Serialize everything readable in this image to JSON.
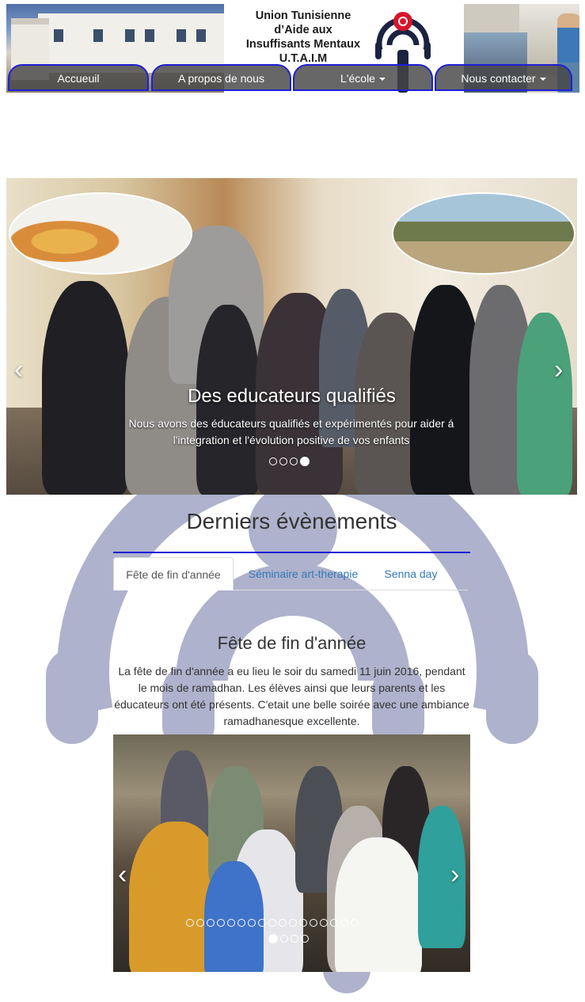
{
  "header": {
    "title_lines": [
      "Union Tunisienne",
      "d’Aide aux",
      "Insuffisants Mentaux",
      "U.T.A.I.M"
    ]
  },
  "nav": {
    "items": [
      {
        "label": "Accueuil",
        "dropdown": false
      },
      {
        "label": "A propos de nous",
        "dropdown": false
      },
      {
        "label": "L'école",
        "dropdown": true
      },
      {
        "label": "Nous contacter",
        "dropdown": true
      }
    ]
  },
  "hero": {
    "caption_title": "Des educateurs qualifiés",
    "caption_text": "Nous avons des éducateurs qualifiés et expérimentés pour aider á l'integration et l'évolution positive de vos enfants",
    "slide_count": 4,
    "active_slide": 4
  },
  "events": {
    "heading": "Derniers évènements",
    "tabs": [
      "Fête de fin d'année",
      "Séminaire art-therapie",
      "Senna day"
    ],
    "active_tab": 0,
    "active": {
      "title": "Fête de fin d'année",
      "text": "La fête de fin d'année a eu lieu le soir du samedi 11 juin 2016, pendant le mois de ramadhan. Les élèves ainsi que leurs parents et les éducateurs ont été présents. C'etait une belle soirée avec une ambiance ramadhanesque excellente."
    },
    "photo_indicator_count": 17,
    "photo_group_count": 4,
    "photo_group_active": 1
  },
  "colors": {
    "nav_border": "#1f1fd6",
    "rule": "#1f1fd6",
    "link": "#337ab7",
    "watermark": "#a3a8c6"
  }
}
